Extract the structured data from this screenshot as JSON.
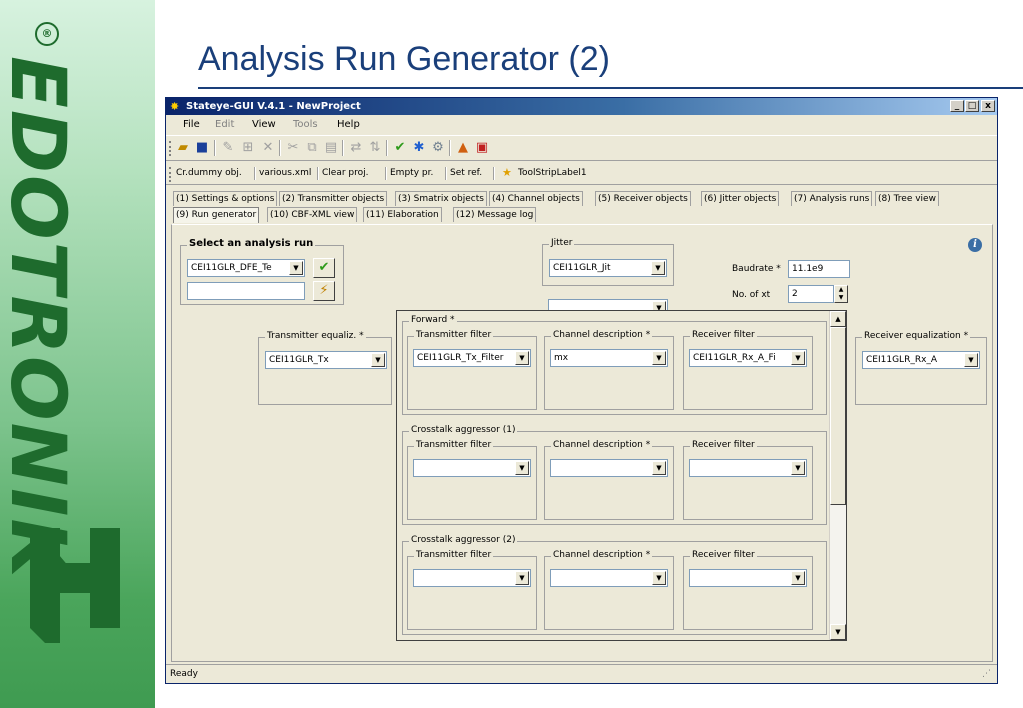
{
  "slide": {
    "title": "Analysis Run Generator (2)",
    "logo_text": "EDOTRONIK",
    "logo_mark": "®"
  },
  "window": {
    "title": "Stateye-GUI V.4.1 - NewProject",
    "minimize": "_",
    "maximize": "□",
    "close": "x"
  },
  "menu": {
    "file": "File",
    "edit": "Edit",
    "view": "View",
    "tools": "Tools",
    "help": "Help"
  },
  "toolbar_icons": [
    "open-folder-icon",
    "save-icon",
    "pen-icon",
    "network-icon",
    "delete-icon",
    "cut-icon",
    "copy-icon",
    "paste-icon",
    "compare-icon",
    "sort-icon",
    "check-icon",
    "star-icon",
    "gear-icon",
    "matlab-icon",
    "document-icon"
  ],
  "strip": {
    "items": [
      "Cr.dummy obj.",
      "various.xml",
      "Clear proj.",
      "Empty pr.",
      "Set ref.",
      "ToolStripLabel1"
    ]
  },
  "tabs": {
    "row1": [
      "(1) Settings & options",
      "(2) Transmitter objects",
      "(3) Smatrix objects",
      "(4) Channel objects",
      "(5) Receiver objects",
      "(6) Jitter objects",
      "(7) Analysis runs",
      "(8) Tree view"
    ],
    "row2": [
      "(9) Run generator",
      "(10) CBF-XML view",
      "(11) Elaboration",
      "(12) Message log"
    ]
  },
  "run": {
    "group_label": "Select an analysis run",
    "combo_value": "CEI11GLR_DFE_Te",
    "name_value": ""
  },
  "jitter": {
    "label": "Jitter",
    "value": "CEI11GLR_Jit",
    "second_value": ""
  },
  "params": {
    "baudrate_label": "Baudrate *",
    "baudrate_value": "11.1e9",
    "noxt_label": "No. of xt",
    "noxt_value": "2"
  },
  "tx_equaliz": {
    "label": "Transmitter equaliz. *",
    "value": "CEI11GLR_Tx"
  },
  "rx_equaliz": {
    "label": "Receiver equalization *",
    "value": "CEI11GLR_Rx_A"
  },
  "forward": {
    "label": "Forward *",
    "tx_filter_label": "Transmitter filter",
    "tx_filter_value": "CEI11GLR_Tx_Filter",
    "channel_label": "Channel description *",
    "channel_value": "mx",
    "rx_filter_label": "Receiver filter",
    "rx_filter_value": "CEI11GLR_Rx_A_Fi"
  },
  "xt1": {
    "label": "Crosstalk aggressor (1)",
    "tx_filter_label": "Transmitter filter",
    "channel_label": "Channel description *",
    "rx_filter_label": "Receiver filter"
  },
  "xt2": {
    "label": "Crosstalk aggressor (2)",
    "tx_filter_label": "Transmitter filter",
    "channel_label": "Channel description *",
    "rx_filter_label": "Receiver filter"
  },
  "status": {
    "text": "Ready"
  }
}
